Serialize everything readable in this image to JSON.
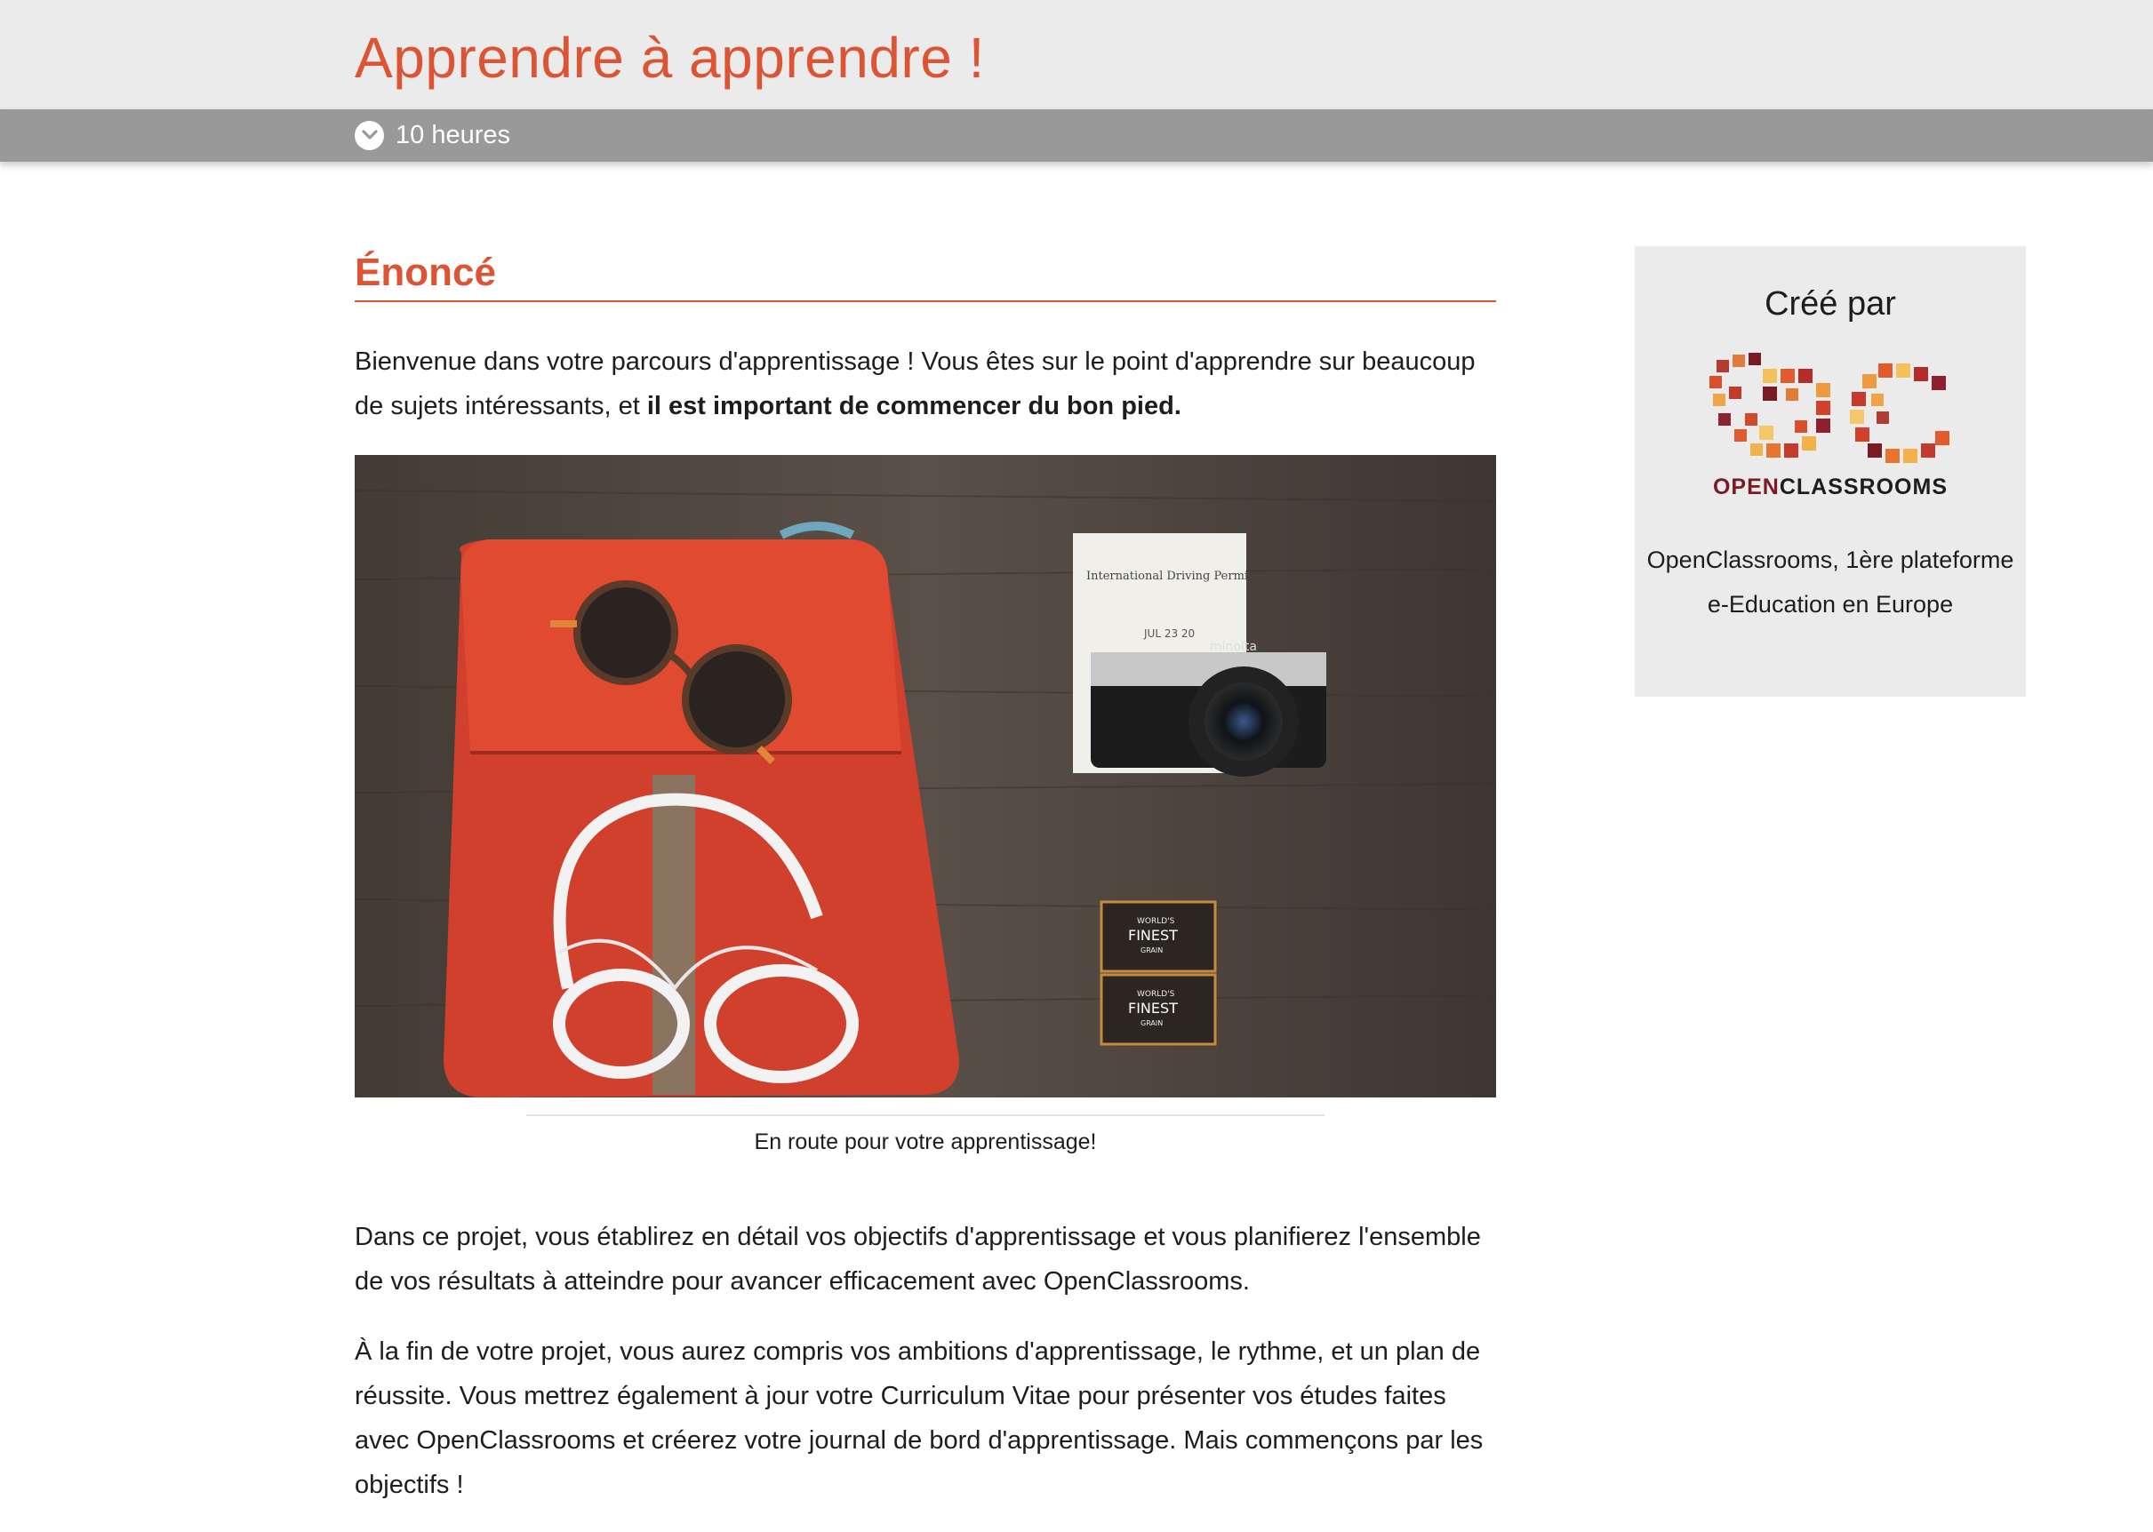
{
  "header": {
    "title": "Apprendre à apprendre !",
    "duration": "10 heures"
  },
  "main": {
    "section_title": "Énoncé",
    "intro_text": "Bienvenue dans votre parcours d'apprentissage ! Vous êtes sur le point d'apprendre  sur beaucoup de sujets intéressants, et ",
    "intro_bold": "il est important de commencer du bon pied.",
    "image_caption": "En route pour votre apprentissage!",
    "paragraph_2": "Dans ce projet, vous établirez en détail vos objectifs d'apprentissage et vous planifierez l'ensemble de vos résultats à atteindre pour avancer efficacement avec OpenClassrooms.",
    "paragraph_3": "À la fin de votre projet, vous aurez compris vos ambitions d'apprentissage, le rythme, et un plan de réussite. Vous mettrez également à jour votre Curriculum Vitae pour présenter vos études faites avec OpenClassrooms et créerez votre journal de bord d'apprentissage. Mais commençons par les objectifs !",
    "photo": {
      "permit_title": "International Driving Permit",
      "permit_date": "JUL 23 20",
      "camera_brand": "minolta",
      "film_label_1": "WORLD'S",
      "film_label_2": "FINEST",
      "film_label_3": "GRAIN"
    }
  },
  "sidebar": {
    "title": "Créé par",
    "logo_word_open": "OPEN",
    "logo_word_classrooms": "CLASSROOMS",
    "description": "OpenClassrooms, 1ère plateforme e-Education en Europe"
  },
  "colors": {
    "accent": "#dd5434",
    "header_bg": "#ebebeb",
    "bar_bg": "#999999"
  }
}
